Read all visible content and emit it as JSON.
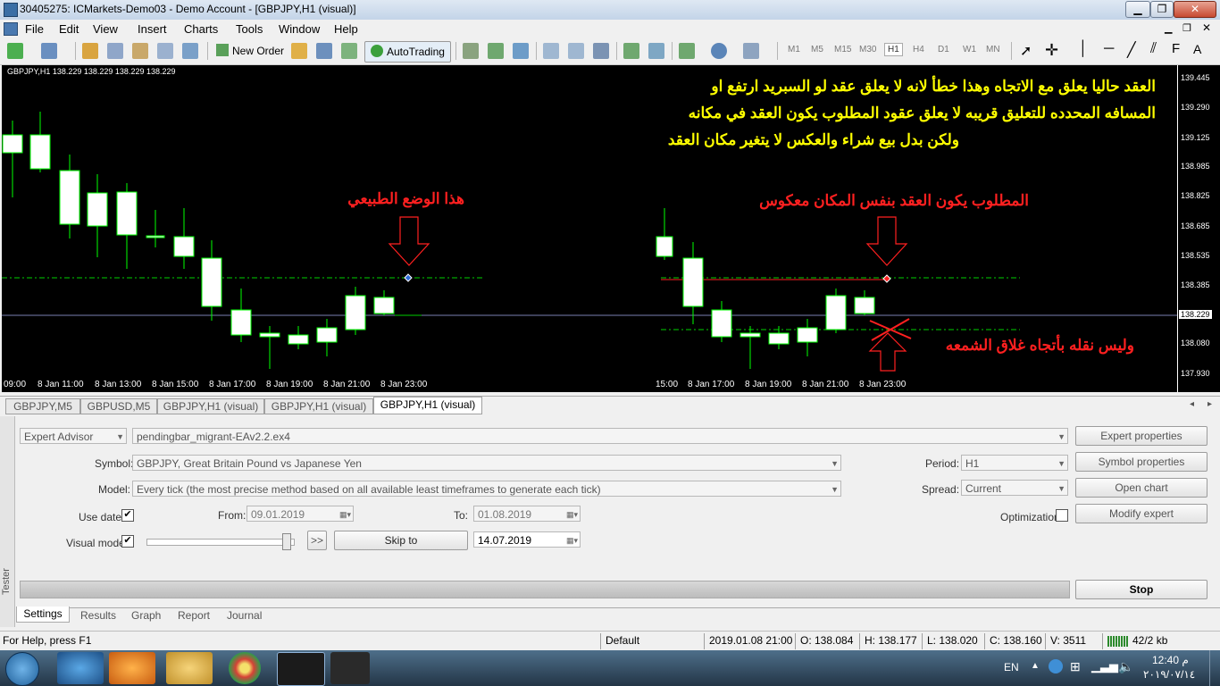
{
  "window": {
    "title": "30405275: ICMarkets-Demo03 - Demo Account - [GBPJPY,H1 (visual)]"
  },
  "menu": {
    "items": [
      "File",
      "Edit",
      "View",
      "Insert",
      "Charts",
      "Tools",
      "Window",
      "Help"
    ]
  },
  "toolbar": {
    "new_order": "New Order",
    "autotrading": "AutoTrading",
    "timeframes": [
      "M1",
      "M5",
      "M15",
      "M30",
      "H1",
      "H4",
      "D1",
      "W1",
      "MN"
    ],
    "active_timeframe": "H1"
  },
  "chart": {
    "header": "GBPJPY,H1  138.229 138.229 138.229 138.229",
    "price_axis": [
      "139.445",
      "139.290",
      "139.125",
      "138.985",
      "138.825",
      "138.685",
      "138.535",
      "138.385",
      "138.229",
      "138.080",
      "137.930"
    ],
    "current_price": "138.229",
    "time_axis": [
      "09:00",
      "8 Jan 11:00",
      "8 Jan 13:00",
      "8 Jan 15:00",
      "8 Jan 17:00",
      "8 Jan 19:00",
      "8 Jan 21:00",
      "8 Jan 23:00",
      "15:00",
      "8 Jan 17:00",
      "8 Jan 19:00",
      "8 Jan 21:00",
      "8 Jan 23:00"
    ],
    "annotation_main_line1": "العقد حاليا يعلق مع الاتجاه وهذا خطأ لانه لا يعلق عقد لو السبريد ارتفع او",
    "annotation_main_line2": "المسافه المحدده للتعليق قريبه لا يعلق عقود المطلوب يكون العقد في مكانه",
    "annotation_main_line3": "ولكن بدل بيع شراء والعكس لا يتغير مكان العقد",
    "annotation_normal": "هذا الوضع الطبيعي",
    "annotation_required": "المطلوب يكون العقد بنفس المكان معكوس",
    "annotation_not_moved": "وليس نقله بأتجاه غلاق الشمعه",
    "colors": {
      "background": "#000000",
      "candle_up": "#ffffff",
      "candle_border": "#00ff00",
      "annotation_yellow": "#ffff00",
      "annotation_red": "#ff2020"
    }
  },
  "chart_tabs": [
    "GBPJPY,M5",
    "GBPUSD,M5",
    "GBPJPY,H1 (visual)",
    "GBPJPY,H1 (visual)",
    "GBPJPY,H1 (visual)"
  ],
  "active_chart_tab": 4,
  "tester": {
    "side_label": "Tester",
    "type_value": "Expert Advisor",
    "expert_file": "pendingbar_migrant-EAv2.2.ex4",
    "symbol_label": "Symbol:",
    "symbol_value": "GBPJPY, Great Britain Pound vs Japanese Yen",
    "model_label": "Model:",
    "model_value": "Every tick (the most precise method based on all available least timeframes to generate each tick)",
    "use_date_label": "Use date",
    "use_date_checked": "✔",
    "from_label": "From:",
    "from_value": "09.01.2019",
    "to_label": "To:",
    "to_value": "01.08.2019",
    "visual_mode_label": "Visual mode",
    "visual_mode_checked": "✔",
    "speed_button": ">>",
    "skip_to_button": "Skip to",
    "skip_to_date": "14.07.2019",
    "period_label": "Period:",
    "period_value": "H1",
    "spread_label": "Spread:",
    "spread_value": "Current",
    "optimization_label": "Optimization",
    "expert_properties": "Expert properties",
    "symbol_properties": "Symbol properties",
    "open_chart": "Open chart",
    "modify_expert": "Modify expert",
    "stop_button": "Stop",
    "tabs": [
      "Settings",
      "Results",
      "Graph",
      "Report",
      "Journal"
    ],
    "active_tab": "Settings"
  },
  "status": {
    "help": "For Help, press F1",
    "profile": "Default",
    "datetime": "2019.01.08 21:00",
    "open": "O: 138.084",
    "high": "H: 138.177",
    "low": "L: 138.020",
    "close": "C: 138.160",
    "volume": "V: 3511",
    "traffic": "42/2 kb"
  },
  "taskbar": {
    "language": "EN",
    "time": "12:40 م",
    "date": "٢٠١٩/٠٧/١٤"
  }
}
